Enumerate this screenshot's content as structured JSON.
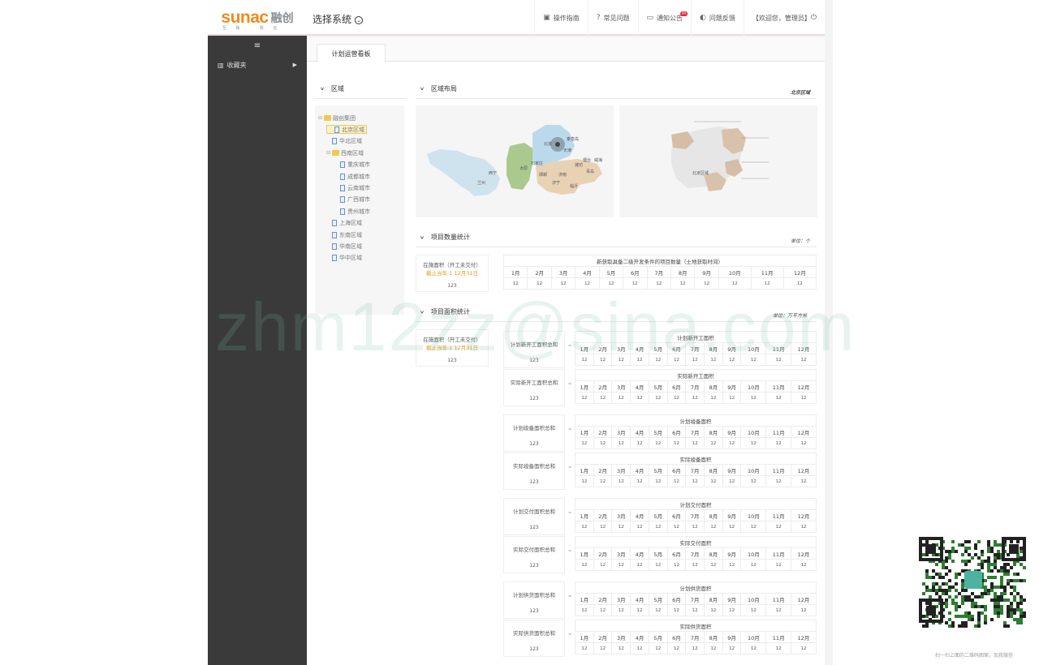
{
  "header": {
    "logo_en": "sunac",
    "logo_cn": "融创",
    "logo_sub": "至 臻 · 致 远",
    "system": "选择系统",
    "nav": [
      {
        "icon": "▣",
        "label": "操作指南"
      },
      {
        "icon": "?",
        "label": "常见问题"
      },
      {
        "icon": "▭",
        "label": "通知公告",
        "badge": "99"
      },
      {
        "icon": "◐",
        "label": "问题反馈"
      },
      {
        "icon": "",
        "label": "【欢迎您，管理员】"
      }
    ]
  },
  "sidebar": {
    "toggle": "≡",
    "favorites": "收藏夹",
    "fav_icon": "▥",
    "arrow": "▶"
  },
  "tab": "计划运营看板",
  "region_title": "区域",
  "tree": [
    {
      "label": "融创集团",
      "kind": "folder",
      "level": 0
    },
    {
      "label": "北京区域",
      "kind": "doc",
      "level": 1,
      "selected": true
    },
    {
      "label": "华北区域",
      "kind": "doc",
      "level": 1
    },
    {
      "label": "西南区域",
      "kind": "folder",
      "level": 1
    },
    {
      "label": "重庆城市",
      "kind": "doc",
      "level": 2
    },
    {
      "label": "成都城市",
      "kind": "doc",
      "level": 2
    },
    {
      "label": "云南城市",
      "kind": "doc",
      "level": 2
    },
    {
      "label": "广西城市",
      "kind": "doc",
      "level": 2
    },
    {
      "label": "贵州城市",
      "kind": "doc",
      "level": 2
    },
    {
      "label": "上海区域",
      "kind": "doc",
      "level": 1
    },
    {
      "label": "东南区域",
      "kind": "doc",
      "level": 1
    },
    {
      "label": "华南区域",
      "kind": "doc",
      "level": 1
    },
    {
      "label": "华中区域",
      "kind": "doc",
      "level": 1
    }
  ],
  "layout": {
    "title": "区域布局",
    "current": "北京区域",
    "map_labels": [
      "北京",
      "天津",
      "太原",
      "石家庄",
      "济南",
      "青岛",
      "兰州",
      "济宁",
      "西宁",
      "秦皇岛",
      "烟台",
      "威海",
      "潍坊",
      "临沂",
      "邯郸",
      "北京区域"
    ]
  },
  "count": {
    "title": "项目数量统计",
    "unit": "单位：个",
    "card": {
      "l1": "在施面积（开工未交付）",
      "l2": "截止当年-1 12月31日",
      "value": "123"
    },
    "table_title": "新获取具备二级开发条件的项目数量（土地获取时间）",
    "months": [
      "1月",
      "2月",
      "3月",
      "4月",
      "5月",
      "6月",
      "7月",
      "8月",
      "9月",
      "10月",
      "11月",
      "12月"
    ],
    "values": [
      "12",
      "12",
      "12",
      "12",
      "12",
      "12",
      "12",
      "12",
      "12",
      "12",
      "12",
      "12"
    ]
  },
  "area": {
    "title": "项目面积统计",
    "unit": "单位：万平方米",
    "card": {
      "l1": "在施面积（开工未交付）",
      "l2": "截止当年-1 12月31日",
      "value": "123"
    },
    "eq": "=",
    "groups": [
      {
        "rows": [
          {
            "label": "计划新开工面积总和",
            "total": "123",
            "title": "计划新开工面积"
          },
          {
            "label": "实际新开工面积总和",
            "total": "123",
            "title": "实际新开工面积"
          }
        ]
      },
      {
        "rows": [
          {
            "label": "计划竣备面积总和",
            "total": "123",
            "title": "计划竣备面积"
          },
          {
            "label": "实际竣备面积总和",
            "total": "123",
            "title": "实际竣备面积"
          }
        ]
      },
      {
        "rows": [
          {
            "label": "计划交付面积总和",
            "total": "123",
            "title": "计划交付面积"
          },
          {
            "label": "实际交付面积总和",
            "total": "123",
            "title": "实际交付面积"
          }
        ]
      },
      {
        "rows": [
          {
            "label": "计划供货面积总和",
            "total": "123",
            "title": "计划供货面积"
          },
          {
            "label": "实际供货面积总和",
            "total": "123",
            "title": "实际供货面积"
          }
        ]
      }
    ]
  },
  "watermark": "zhm12zz@sina.com",
  "qr_caption": "扫一扫上面的二维码图案，加我微信"
}
